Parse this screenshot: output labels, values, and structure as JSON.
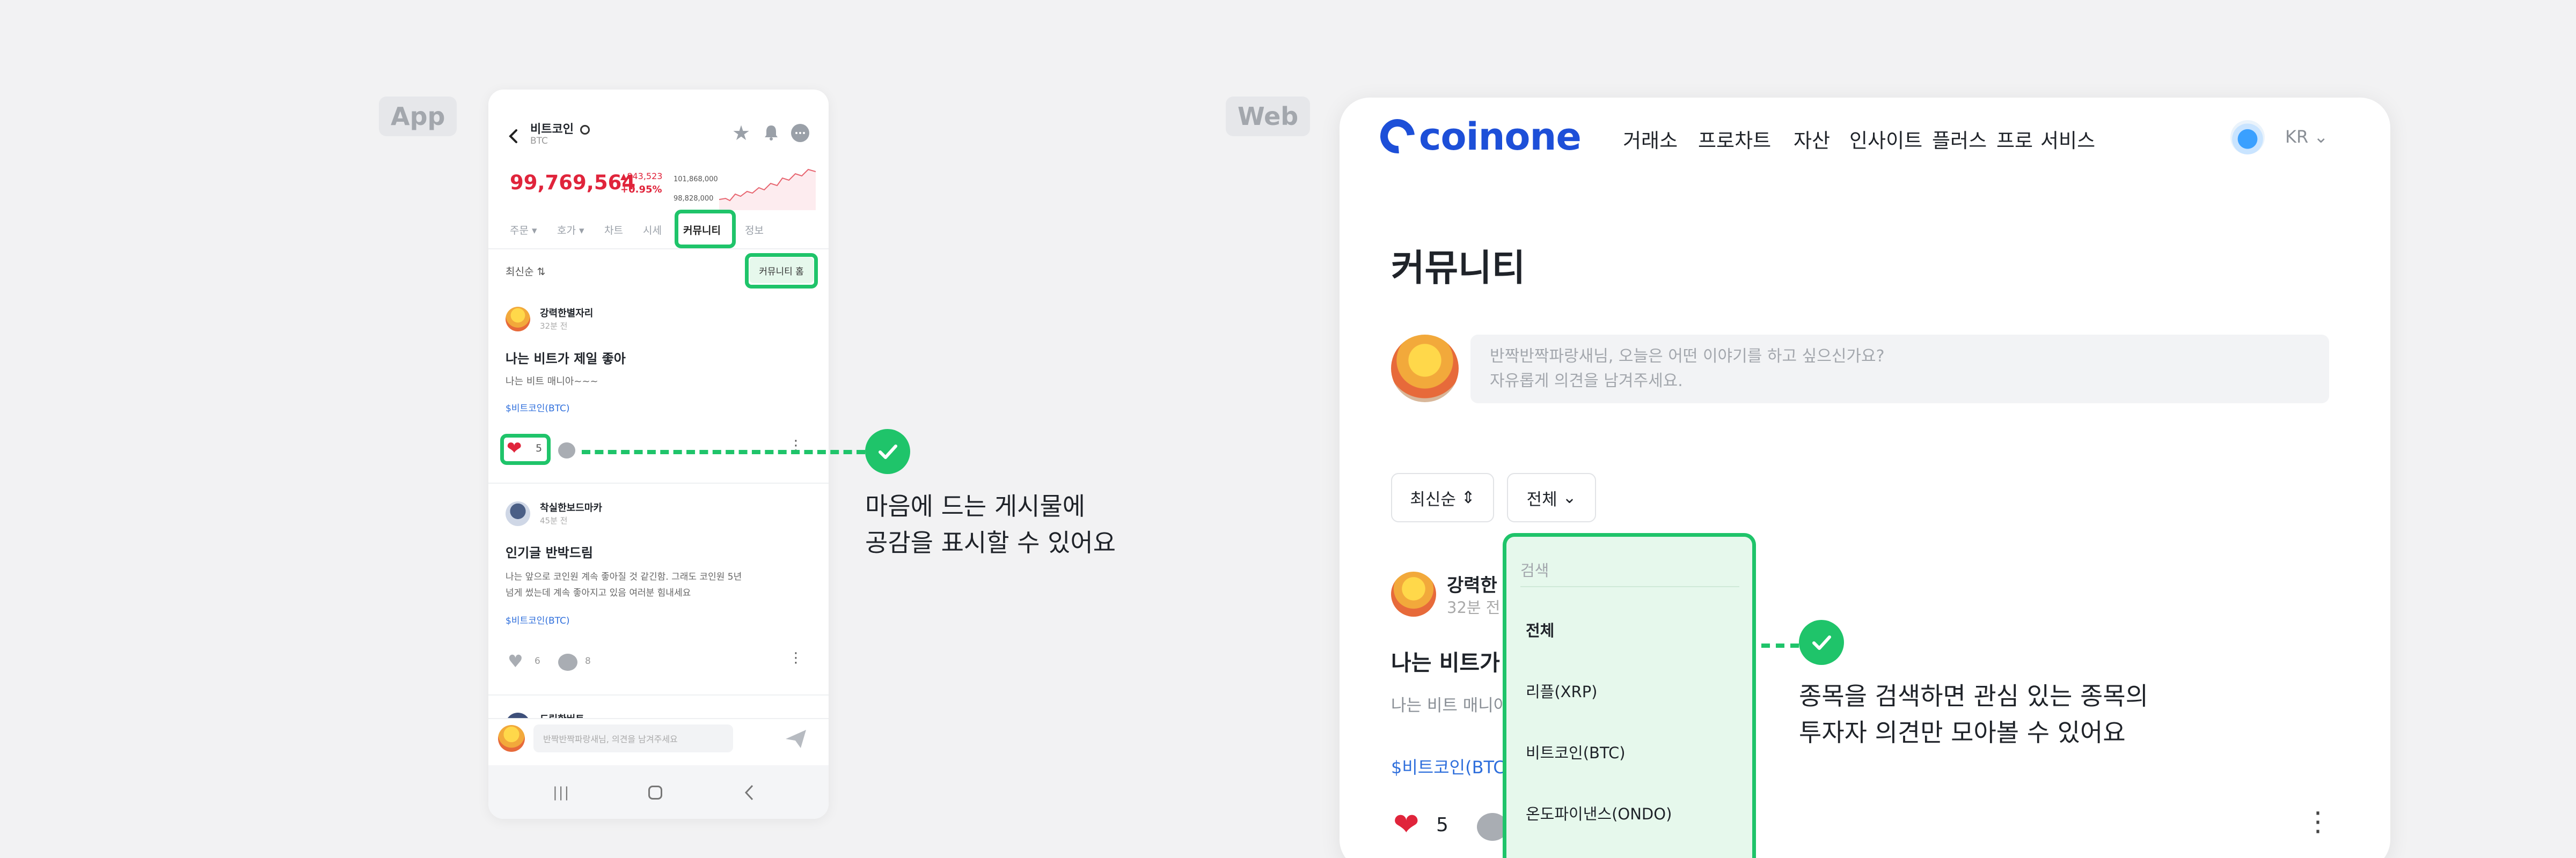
{
  "labels": {
    "app": "App",
    "web": "Web"
  },
  "app": {
    "header": {
      "title": "비트코인",
      "subtitle": "BTC"
    },
    "price": {
      "value": "99,769,564",
      "change_amount": "▲843,523",
      "change_pct": "+0.95%",
      "high_label": "101,868,000",
      "low_label": "98,828,000"
    },
    "tabs": [
      "주문",
      "호가",
      "차트",
      "시세",
      "커뮤니티",
      "정보"
    ],
    "sort_label": "최신순",
    "community_home_button": "커뮤니티 홈",
    "posts": [
      {
        "author": "강력한별자리",
        "time": "32분 전",
        "title": "나는 비트가 제일 좋아",
        "body": "나는 비트 매니아~~~",
        "tag": "$비트코인(BTC)",
        "likes": "5"
      },
      {
        "author": "착실한보드마카",
        "time": "45분 전",
        "title": "인기글 반박드림",
        "body_line1": "나는 앞으로 코인원 계속 좋아질 것 같긴함. 그래도 코인원 5년",
        "body_line2": "넘게 썼는데 계속 좋아지고 있음 여러분 힘내세요",
        "tag": "$비트코인(BTC)",
        "likes": "6",
        "comments": "8"
      },
      {
        "author": "드림한버트"
      }
    ],
    "comment_placeholder": "반짝반짝파랑새님, 의견을 남겨주세요"
  },
  "web": {
    "logo": "coinone",
    "nav": [
      "거래소",
      "프로차트",
      "자산",
      "인사이트",
      "플러스",
      "프로",
      "서비스"
    ],
    "lang": "KR",
    "page_title": "커뮤니티",
    "compose_placeholder_line1": "반짝반짝파랑새님, 오늘은 어떤 이야기를 하고 싶으신가요?",
    "compose_placeholder_line2": "자유롭게 의견을 남겨주세요.",
    "sort_label": "최신순",
    "filter_label": "전체",
    "post": {
      "author": "강력한",
      "time": "32분 전",
      "title": "나는 비트가 제",
      "body": "나는 비트 매니아",
      "tag": "$비트코인(BTC)",
      "likes": "5"
    },
    "dropdown": {
      "search_placeholder": "검색",
      "options": [
        "전체",
        "리플(XRP)",
        "비트코인(BTC)",
        "온도파이낸스(ONDO)"
      ]
    }
  },
  "callouts": {
    "like_line1": "마음에 드는 게시물에",
    "like_line2": "공감을 표시할 수 있어요",
    "search_line1": "종목을 검색하면 관심 있는 종목의",
    "search_line2": "투자자 의견만 모아볼 수 있어요"
  },
  "colors": {
    "accent_green": "#1fc46a",
    "price_red": "#e0243b",
    "brand_blue": "#1d4fd8",
    "tag_blue": "#2f6fdc"
  }
}
